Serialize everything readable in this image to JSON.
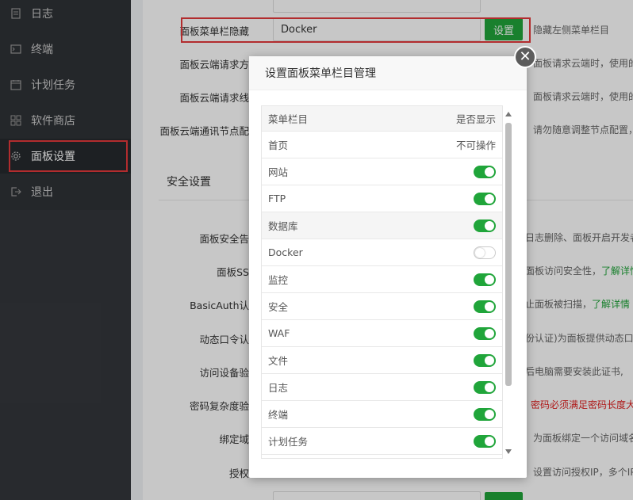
{
  "sidebar": {
    "items": [
      {
        "label": "日志",
        "icon": "log-icon"
      },
      {
        "label": "终端",
        "icon": "terminal-icon"
      },
      {
        "label": "计划任务",
        "icon": "calendar-icon"
      },
      {
        "label": "软件商店",
        "icon": "grid-icon"
      },
      {
        "label": "面板设置",
        "icon": "gear-icon"
      },
      {
        "label": "退出",
        "icon": "logout-icon"
      }
    ]
  },
  "settings": {
    "menu_hide_label": "面板菜单栏隐藏",
    "menu_hide_value": "Docker",
    "set_button": "设置",
    "menu_hide_desc": "隐藏左侧菜单栏目",
    "cloud_req_label": "面板云端请求方",
    "cloud_req_desc": "面板请求云端时，使用的",
    "cloud_line_label": "面板云端请求线",
    "cloud_line_desc": "面板请求云端时，使用的",
    "cloud_node_label": "面板云端通讯节点配",
    "cloud_node_desc": "请勿随意调整节点配置，",
    "security_section": "安全设置",
    "alarm_label": "面板安全告",
    "alarm_desc": "日志删除、面板开启开发者",
    "ssl_label": "面板SS",
    "ssl_desc": "面板访问安全性，",
    "ssl_link": "了解详情",
    "basicauth_label": "BasicAuth认",
    "basicauth_desc": "止面板被扫描，",
    "basicauth_link": "了解详情",
    "otp_label": "动态口令认",
    "otp_desc": "份认证)为面板提供动态口",
    "device_label": "访问设备验",
    "device_desc": "后电脑需要安装此证书,",
    "pwd_label": "密码复杂度验",
    "pwd_desc": "密码必须满足密码长度大",
    "domain_label": "绑定域",
    "domain_desc": "为面板绑定一个访问域名",
    "ip_label": "授权",
    "ip_desc": "设置访问授权IP，多个IP"
  },
  "modal": {
    "title": "设置面板菜单栏目管理",
    "col_item": "菜单栏目",
    "col_show": "是否显示",
    "rows": [
      {
        "name": "首页",
        "status": "不可操作"
      },
      {
        "name": "网站",
        "on": true
      },
      {
        "name": "FTP",
        "on": true
      },
      {
        "name": "数据库",
        "on": true
      },
      {
        "name": "Docker",
        "on": false
      },
      {
        "name": "监控",
        "on": true
      },
      {
        "name": "安全",
        "on": true
      },
      {
        "name": "WAF",
        "on": true
      },
      {
        "name": "文件",
        "on": true
      },
      {
        "name": "日志",
        "on": true
      },
      {
        "name": "终端",
        "on": true
      },
      {
        "name": "计划任务",
        "on": true
      }
    ]
  },
  "colors": {
    "accent": "#20a53a",
    "sidebar_bg": "#34373c",
    "highlight": "#e5393b"
  }
}
